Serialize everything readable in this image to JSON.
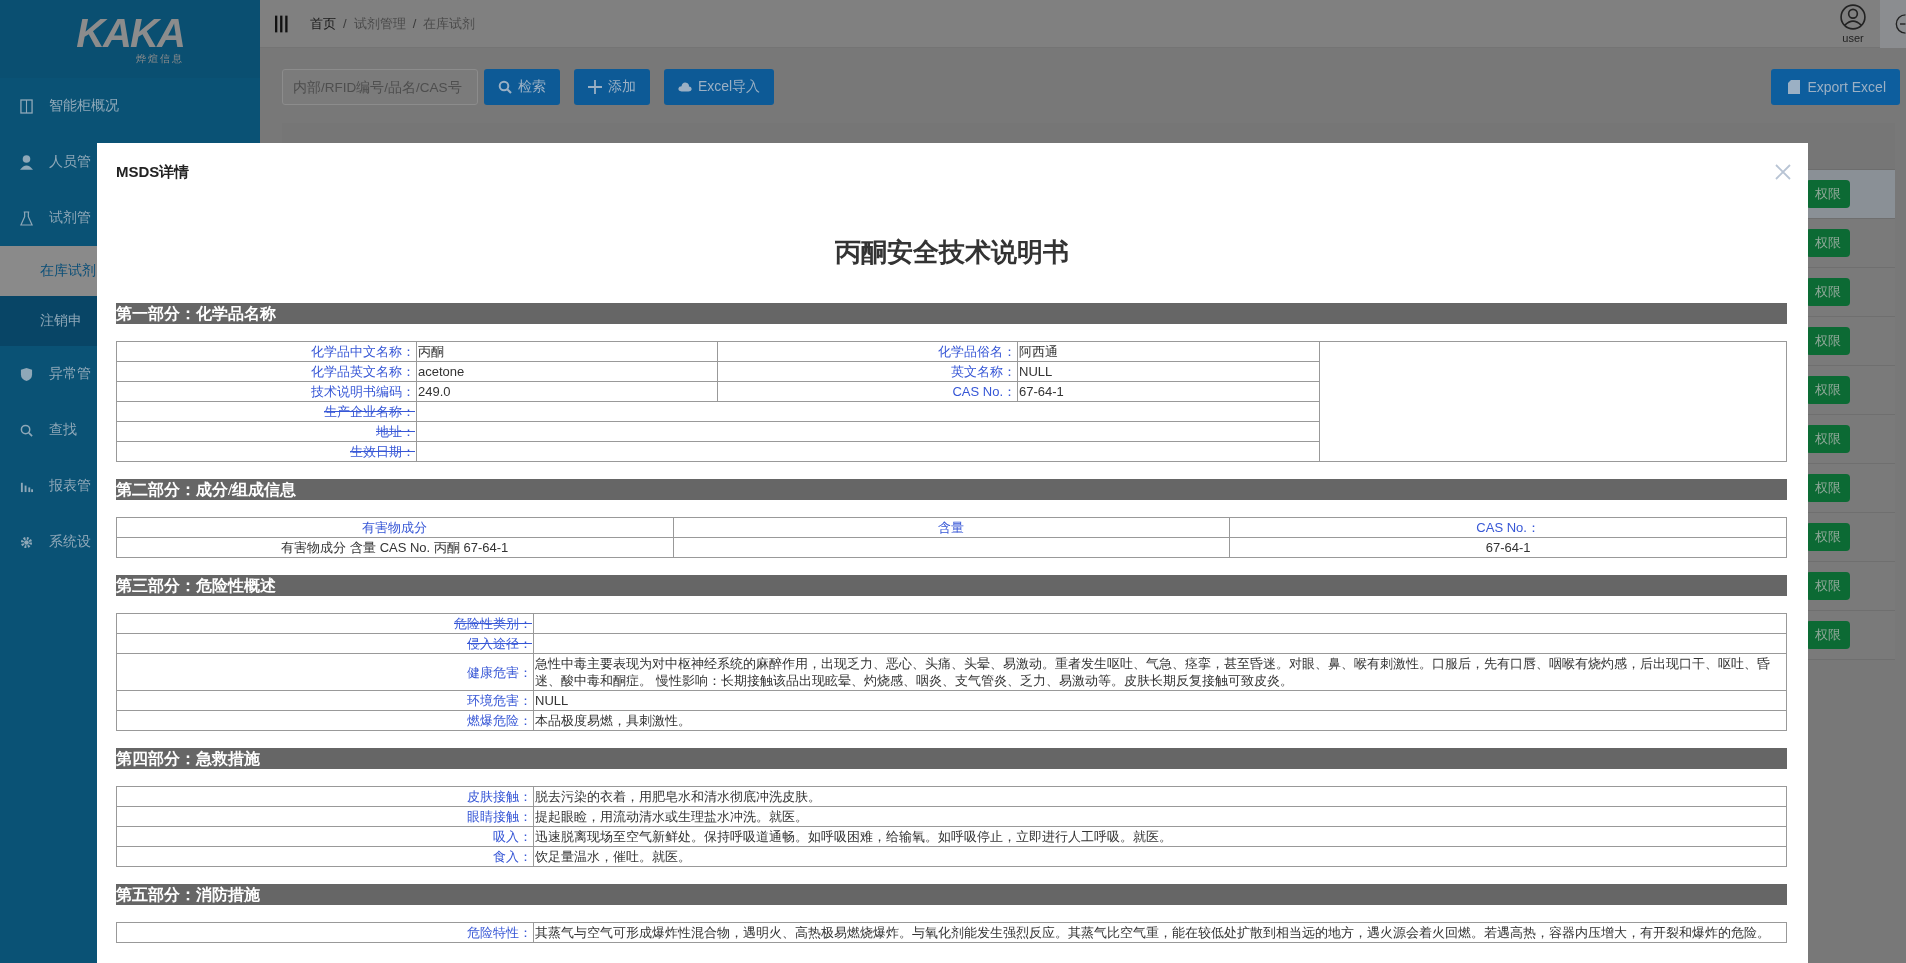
{
  "sidebar": {
    "logo": "KAKA",
    "logo_sub": "烨煊信息",
    "items": [
      {
        "label": "智能柜概况",
        "kind": "item",
        "selected": false
      },
      {
        "label": "人员管",
        "kind": "item",
        "selected": false
      },
      {
        "label": "试剂管",
        "kind": "item",
        "selected": false
      },
      {
        "label": "在库试剂",
        "kind": "sub",
        "selected": true
      },
      {
        "label": "注销申",
        "kind": "sub",
        "selected": false
      },
      {
        "label": "异常管",
        "kind": "item",
        "selected": false
      },
      {
        "label": "查找",
        "kind": "item",
        "selected": false
      },
      {
        "label": "报表管",
        "kind": "item",
        "selected": false
      },
      {
        "label": "系统设",
        "kind": "item",
        "selected": false
      }
    ]
  },
  "header": {
    "breadcrumb": [
      "首页",
      "试剂管理",
      "在库试剂"
    ],
    "separator": "/",
    "user": "user"
  },
  "toolbar": {
    "search_placeholder": "内部/RFID编号/品名/CAS号",
    "buttons": [
      {
        "label": "检索",
        "kind": "search"
      },
      {
        "label": "添加",
        "kind": "add"
      },
      {
        "label": "Excel导入",
        "kind": "upload"
      }
    ],
    "export": "Export Excel"
  },
  "table": {
    "rows": [
      {
        "action": "权限",
        "selected": true
      },
      {
        "action": "权限",
        "selected": false
      },
      {
        "action": "权限",
        "selected": false
      },
      {
        "action": "权限",
        "selected": false
      },
      {
        "action": "权限",
        "selected": false
      },
      {
        "action": "权限",
        "selected": false
      },
      {
        "action": "权限",
        "selected": false
      },
      {
        "action": "权限",
        "selected": false
      },
      {
        "action": "权限",
        "selected": false
      },
      {
        "action": "权限",
        "selected": false
      }
    ]
  },
  "modal": {
    "title": "MSDS详情",
    "doc_title": "丙酮安全技术说明书",
    "sections": [
      {
        "title": "第一部分：化学品名称",
        "kind": "grid",
        "rows": [
          {
            "struck": false,
            "cells": [
              {
                "label": "化学品中文名称：",
                "value": "丙酮"
              },
              {
                "label": "化学品俗名：",
                "value": "阿西通"
              }
            ]
          },
          {
            "struck": false,
            "cells": [
              {
                "label": "化学品英文名称：",
                "value": "acetone"
              },
              {
                "label": "英文名称：",
                "value": "NULL"
              }
            ]
          },
          {
            "struck": false,
            "cells": [
              {
                "label": "技术说明书编码：",
                "value": "249.0"
              },
              {
                "label": "CAS No.：",
                "value": "67-64-1"
              }
            ]
          },
          {
            "struck": true,
            "cells": [
              {
                "label": "生产企业名称："
              }
            ]
          },
          {
            "struck": true,
            "cells": [
              {
                "label": "地址："
              }
            ]
          },
          {
            "struck": true,
            "cells": [
              {
                "label": "生效日期："
              }
            ]
          }
        ]
      },
      {
        "title": "第二部分：成分/组成信息",
        "kind": "columns",
        "header": [
          "有害物成分",
          "含量",
          "CAS No.："
        ],
        "rows": [
          [
            "有害物成分 含量 CAS No. 丙酮 67-64-1",
            null,
            "67-64-1"
          ]
        ]
      },
      {
        "title": "第三部分：危险性概述",
        "kind": "fields",
        "rows": [
          {
            "label": "危险性类别：",
            "struck": true
          },
          {
            "label": "侵入途径：",
            "struck": true
          },
          {
            "label": "健康危害：",
            "struck": false,
            "value": "急性中毒主要表现为对中枢神经系统的麻醉作用，出现乏力、恶心、头痛、头晕、易激动。重者发生呕吐、气急、痉挛，甚至昏迷。对眼、鼻、喉有刺激性。口服后，先有口唇、咽喉有烧灼感，后出现口干、呕吐、昏迷、酸中毒和酮症。 慢性影响：长期接触该品出现眩晕、灼烧感、咽炎、支气管炎、乏力、易激动等。皮肤长期反复接触可致皮炎。"
          },
          {
            "label": "环境危害：",
            "struck": false,
            "value": "NULL"
          },
          {
            "label": "燃爆危险：",
            "struck": false,
            "value": "本品极度易燃，具刺激性。"
          }
        ]
      },
      {
        "title": "第四部分：急救措施",
        "kind": "fields",
        "rows": [
          {
            "label": "皮肤接触：",
            "struck": false,
            "value": "脱去污染的衣着，用肥皂水和清水彻底冲洗皮肤。"
          },
          {
            "label": "眼睛接触：",
            "struck": false,
            "value": "提起眼睑，用流动清水或生理盐水冲洗。就医。"
          },
          {
            "label": "吸入：",
            "struck": false,
            "value": "迅速脱离现场至空气新鲜处。保持呼吸道通畅。如呼吸困难，给输氧。如呼吸停止，立即进行人工呼吸。就医。"
          },
          {
            "label": "食入：",
            "struck": false,
            "value": "饮足量温水，催吐。就医。"
          }
        ]
      },
      {
        "title": "第五部分：消防措施",
        "kind": "fields",
        "rows": [
          {
            "label": "危险特性：",
            "struck": false,
            "value": "其蒸气与空气可形成爆炸性混合物，遇明火、高热极易燃烧爆炸。与氧化剂能发生强烈反应。其蒸气比空气重，能在较低处扩散到相当远的地方，遇火源会着火回燃。若遇高热，容器内压增大，有开裂和爆炸的危险。"
          }
        ]
      }
    ]
  }
}
